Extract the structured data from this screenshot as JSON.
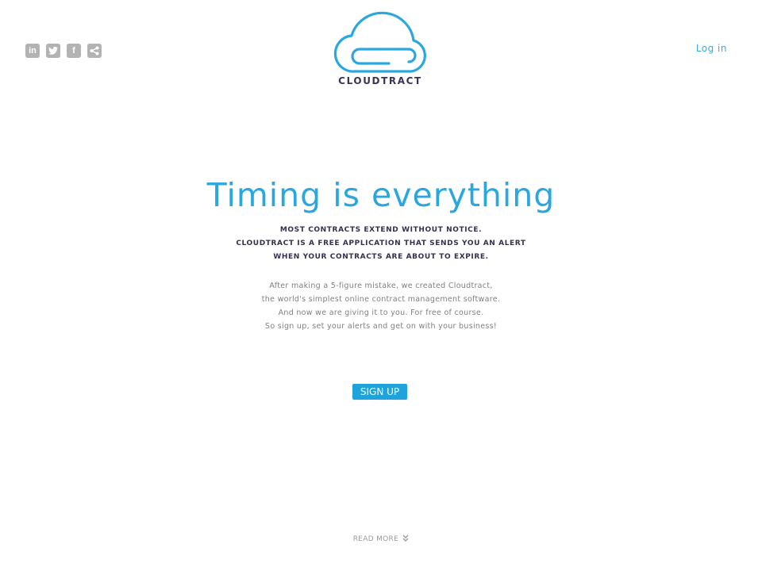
{
  "header": {
    "social": [
      {
        "name": "linkedin-icon",
        "glyph": "in"
      },
      {
        "name": "twitter-icon",
        "glyph": ""
      },
      {
        "name": "facebook-icon",
        "glyph": "f"
      },
      {
        "name": "share-icon",
        "glyph": ""
      }
    ],
    "login_label": "Log in",
    "logo_text": "CLOUDTRACT"
  },
  "hero": {
    "title": "Timing is everything",
    "tagline": [
      "MOST CONTRACTS EXTEND WITHOUT NOTICE.",
      "CLOUDTRACT IS A FREE APPLICATION THAT SENDS YOU AN ALERT",
      "WHEN YOUR CONTRACTS ARE ABOUT TO EXPIRE."
    ],
    "body": [
      "After making a 5-figure mistake, we created Cloudtract,",
      "the world's simplest online contract management software.",
      "And now we are giving it to you. For free of course.",
      "So sign up, set your alerts and get on with your business!"
    ],
    "signup_label": "SIGN UP",
    "read_more_label": "READ MORE"
  },
  "colors": {
    "brand_blue": "#2aa7df",
    "brand_dark": "#3a3557",
    "icon_gray": "#b3b3b3"
  }
}
